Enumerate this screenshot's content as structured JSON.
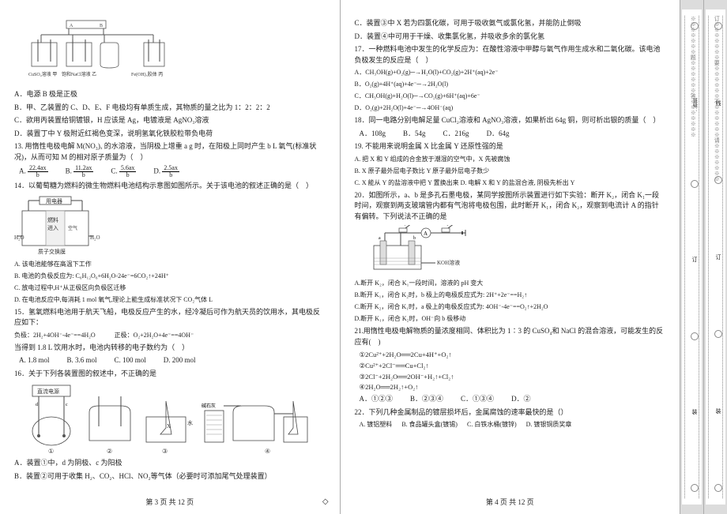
{
  "page3": {
    "fig1_labels": {
      "a": "A",
      "b": "B",
      "left": "CuSO₄溶液 甲",
      "mid": "饱和NaCl溶液 乙",
      "right": "Fe(OH)₃胶体 丙"
    },
    "q12_optA": "A．电源 B 极是正极",
    "q12_optB": "B．甲、乙装置的 C、D、E、F 电极均有单质生成，其物质的量之比为 1：2：2：2",
    "q12_optC": "C．欲用丙装置给铜镀银，H 应该是 Ag，电镀液是 AgNO₃溶液",
    "q12_optD": "D．装置丁中 Y 极附近红褐色变深，说明氢氧化铁胶粒带负电荷",
    "q13": "13. 用惰性电极电解 M(NO₃)ₓ 的水溶液，当阴极上增重 a g 时，在阳极上同时产生 b L 氧气(标准状况)，从而可知 M 的相对原子质量为（　）",
    "q13A": "A.",
    "q13B": "B.",
    "q13C": "C.",
    "q13D": "D.",
    "q13A_n": "22.4ax",
    "q13A_d": "b",
    "q13B_n": "11.2ax",
    "q13B_d": "b",
    "q13C_n": "5.6ax",
    "q13C_d": "b",
    "q13D_n": "2.5ax",
    "q13D_d": "b",
    "q14": "14．以葡萄糖为燃料的微生物燃料电池结构示意图如图所示。关于该电池的叙述正确的是（　）",
    "fig2_labels": {
      "top": "用电器",
      "mid": "燃料",
      "right": "空气",
      "l": "H₂O",
      "r": "H₂O",
      "bottom": "质子交换膜"
    },
    "q14A": "A. 该电池能够在高温下工作",
    "q14B": "B. 电池的负极反应为: C₆H₁₂O₆+6H₂O-24e⁻=6CO₂↑+24H⁺",
    "q14C": "C. 放电过程中,H⁺从正极区向负极区迁移",
    "q14D": "D. 在电池反应中,每消耗 1 mol 氧气,理论上能生成标准状况下 CO₂气体 L",
    "q15": "15．氢氧燃料电池用于航天飞船，电极反应产生的水，经冷凝后可作为航天员的饮用水，其电极反应如下：",
    "q15_neg": "负极：2H₂+4OH⁻-4e⁻==4H₂O　　　正极：O₂+2H₂O+4e⁻==4OH⁻",
    "q15_q": "当得到 1.8 L 饮用水时，电池内转移的电子数约为（　）",
    "q15A": "A. 1.8 mol",
    "q15B": "B. 3.6 mol",
    "q15C": "C. 100 mol",
    "q15D": "D. 200 mol",
    "q16": "16．关于下列各装置图的叙述中，不正确的是",
    "fig3_labels": {
      "pwr": "直流电源",
      "d1": "①",
      "d2": "②",
      "d3": "③",
      "d4": "④",
      "water": "水",
      "lime": "碱石灰",
      "x": "X"
    },
    "q16A": "A．装置①中，d 为阴极、c 为阳极",
    "q16B": "B．装置②可用于收集 H₂、CO₂、HCl、NO₂等气体（必要时可添加尾气处理装置）",
    "footer": "第 3 页  共 12 页"
  },
  "page4": {
    "q16C": "C．装置③中 X 若为四氯化碳，可用于吸收氨气或氯化氢，并能防止倒吸",
    "q16D": "D．装置④中可用于干燥、收集氯化氢，并吸收多余的氯化氢",
    "q17": "17．一种燃料电池中发生的化学反应为：在酸性溶液中甲醇与氧气作用生成水和二氧化碳。该电池负极发生的反应是（　）",
    "q17A": "A．CH₃OH(g)+O₂(g)─→H₂O(l)+CO₂(g)+2H⁺(aq)+2e⁻",
    "q17B": "B．O₂(g)+4H⁺(aq)+4e⁻─→2H₂O(l)",
    "q17C": "C．CH₃OH(g)+H₂O(l)─→CO₂(g)+6H⁺(aq)+6e⁻",
    "q17D": "D．O₂(g)+2H₂O(l)+4e⁻─→4OH⁻(aq)",
    "q18": "18．同一电路分别电解足量 CuCl₂溶液和 AgNO₃溶液，如果析出 64g 铜，则可析出银的质量（　）",
    "q18A": "A．108g",
    "q18B": "B．54g",
    "q18C": "C．216g",
    "q18D": "D．64g",
    "q19": "19. 不能用来说明金属 X 比金属 Y 还原性强的是",
    "q19A": "A. 把 X 和 Y 组成的合金放于潮湿的空气中，X 先被腐蚀",
    "q19B": "B. X 原子最外层电子数比 Y 原子最外层电子数少",
    "q19C": "C. X 能从 Y 的盐溶液中把 Y 置换出来   D. 电解 X 和 Y 的盐混合液, 阴极先析出 Y",
    "q20": "20．如图所示，a、b 是多孔石墨电极，某同学按图所示装置进行如下实验：断开 K₂，闭合 K₁一段时间，观察到两支玻璃管内都有气泡将电极包围，此时断开 K₁，闭合 K₂，观察到电流计 A 的指针有偏转。下列说法不正确的是",
    "fig4_label": "KOH溶液",
    "q20A": "A.断开 K₂，闭合 K₁一段时间，溶液的 pH 变大",
    "q20B": "B.断开 K₁，闭合 K₂时，b 极上的电极反应式为: 2H⁺+2e⁻==H₂↑",
    "q20C": "C.断开 K₂，闭合 K₁时，a 极上的电极反应式为: 4OH⁻-4e⁻==O₂↑+2H₂O",
    "q20D": "D.断开 K₁，闭合 K₂时，OH⁻向 b 极移动",
    "q21": "21.用惰性电极电解物质的量浓度相同、体积比为 1∶3 的 CuSO₄和 NaCl 的混合溶液，可能发生的反应有(　)",
    "r1": "①2Cu²⁺+2H₂O══2Cu+4H⁺+O₂↑",
    "r2": "②Cu²⁺+2Cl⁻══Cu+Cl₂↑",
    "r3": "③2Cl⁻+2H₂O══2OH⁻+H₂↑+Cl₂↑",
    "r4": "④2H₂O══2H₂↑+O₂↑",
    "r_top": "电解",
    "q21A": "A．①②③",
    "q21B": "B．②③④",
    "q21C": "C．①③④",
    "q21D": "D．②",
    "q22": "22．下列几种金属制品的镀层损坏后，金属腐蚀的速率最快的是（）",
    "q22A": "A. 镀铝塑料",
    "q22B": "B. 食品罐头盒(镀锡)",
    "q22C": "C. 白铁水桶(镀锌)",
    "q22D": "D. 镀银铜质奖章",
    "footer": "第 4 页  共 12 页"
  },
  "side": {
    "text1": "※※※※※※※题※※※※※※答※※※※※※※",
    "text2": "订※※※※※※※要※※※※※※不※※※※※※请※※※※※※※",
    "lbl1": "班级：",
    "lbl2": "线",
    "lbl3": "订",
    "lbl4": "装",
    "lbl5": "※"
  }
}
